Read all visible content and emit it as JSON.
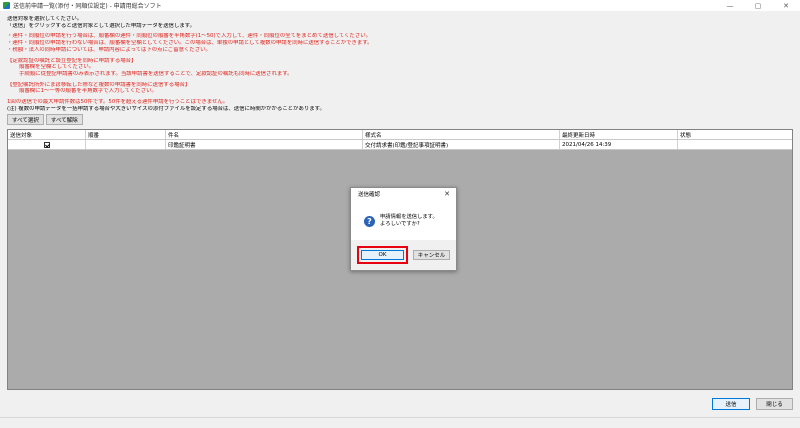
{
  "window": {
    "title": "送信前申請一覧(添付・同順位設定) - 申請用総合ソフト",
    "minimize": "—",
    "maximize": "▢",
    "close": "✕"
  },
  "instructions": {
    "l1": "送信対象を選択してください。",
    "l2": "「送信」をクリックすると送信対象として選択した申請データを送信します。",
    "r1": "・連件・同順位の申請を行う場合は、順番欄の連件・同順位の順番を半角数字(1～50)で入力して、連件・同順位の全てをまとめて送信してください。",
    "r2": "・連件・同順位の申請を行わない場合は、順番欄を空欄としてください。この場合は、単独の申請として複数の申請を同時に送信することができます。",
    "r3": "・税額・法人の同時申請については、申請内容によっては下の点にご留意ください。",
    "r4": "【定款認証の嘱託と設立登記を同時に申請する場合】",
    "r5": "順番欄を空欄としてください。",
    "r6": "手続順に従登記申請書のみ表示されます。当該申請書を送信することで、定款認証の嘱託も同時に送信されます。",
    "r7": "【登記嘱託所外にまぼ移転した際など複数の申請書を同時に送信する場合】",
    "r8": "順番欄に1～一等の順番を半角数字で入力してください。",
    "r9": "1回の送信での最大申請件数は50件です。50件を超える連件申請を行うことはできません。",
    "l3": "(注) 複数の申請データを一括申請する場合や大きいサイズの添付ファイルを設定する場合は、送信に時間がかかることがあります。"
  },
  "buttons": {
    "select_all": "すべて選択",
    "deselect_all": "すべて解除",
    "send": "送信",
    "close": "閉じる"
  },
  "table": {
    "headers": [
      "送信対象",
      "順番",
      "件名",
      "様式名",
      "最終更新日時",
      "状態"
    ],
    "rows": [
      {
        "checked": true,
        "order": "",
        "subject": "印鑑証明書",
        "form": "交付請求書(印鑑/登記事項証明書)",
        "updated": "2021/04/26 14:39",
        "status": ""
      }
    ]
  },
  "dialog": {
    "title": "送信確認",
    "close": "✕",
    "icon": "?",
    "message1": "申請情報を送信します。",
    "message2": "よろしいですか?",
    "ok": "OK",
    "cancel": "キャンセル"
  }
}
